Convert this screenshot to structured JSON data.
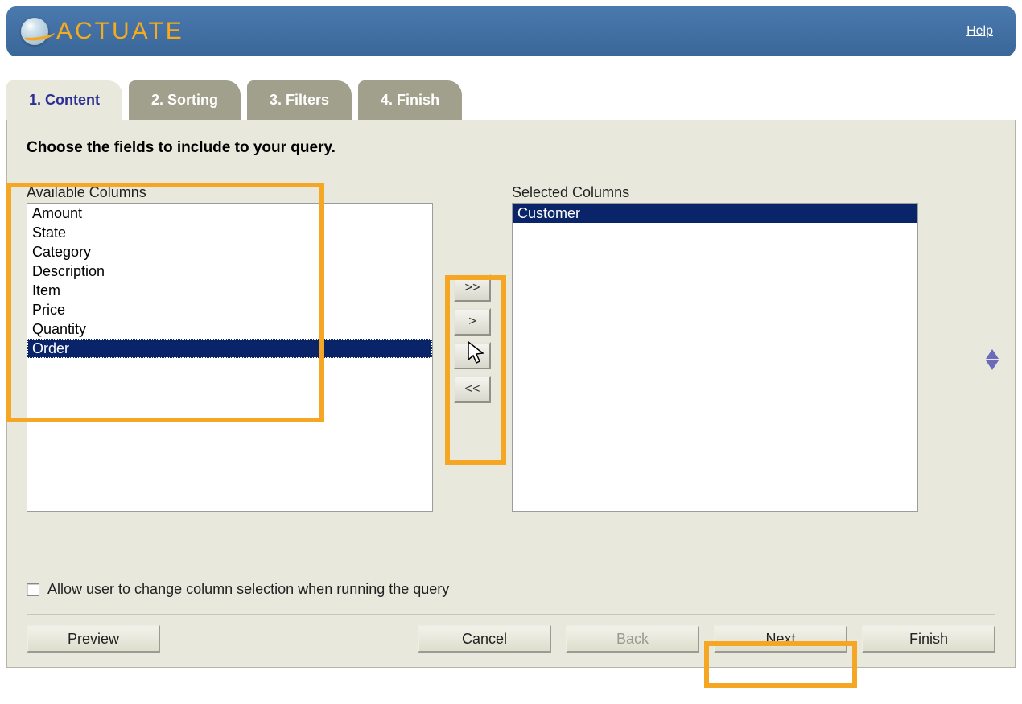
{
  "brand": "ACTUATE",
  "header": {
    "help": "Help"
  },
  "tabs": [
    {
      "label": "1. Content",
      "active": true
    },
    {
      "label": "2. Sorting",
      "active": false
    },
    {
      "label": "3. Filters",
      "active": false
    },
    {
      "label": "4. Finish",
      "active": false
    }
  ],
  "instruction": "Choose the fields to include to your query.",
  "available": {
    "label": "Available Columns",
    "items": [
      {
        "text": "Amount",
        "selected": false
      },
      {
        "text": "State",
        "selected": false
      },
      {
        "text": "Category",
        "selected": false
      },
      {
        "text": "Description",
        "selected": false
      },
      {
        "text": "Item",
        "selected": false
      },
      {
        "text": "Price",
        "selected": false
      },
      {
        "text": "Quantity",
        "selected": false
      },
      {
        "text": "Order",
        "selected": true
      }
    ]
  },
  "selected": {
    "label": "Selected Columns",
    "items": [
      {
        "text": "Customer",
        "selected": true
      }
    ]
  },
  "transfer": {
    "add_all": ">>",
    "add": ">",
    "remove": "<",
    "remove_all": "<<"
  },
  "checkbox": {
    "checked": false,
    "label": "Allow user to change column selection when running the query"
  },
  "footer": {
    "preview": "Preview",
    "cancel": "Cancel",
    "back": "Back",
    "next": "Next",
    "finish": "Finish"
  },
  "colors": {
    "highlight": "#f5a623",
    "selection_bg": "#0a246a",
    "header_bg": "#3a6799",
    "panel_bg": "#e8e8dc"
  }
}
